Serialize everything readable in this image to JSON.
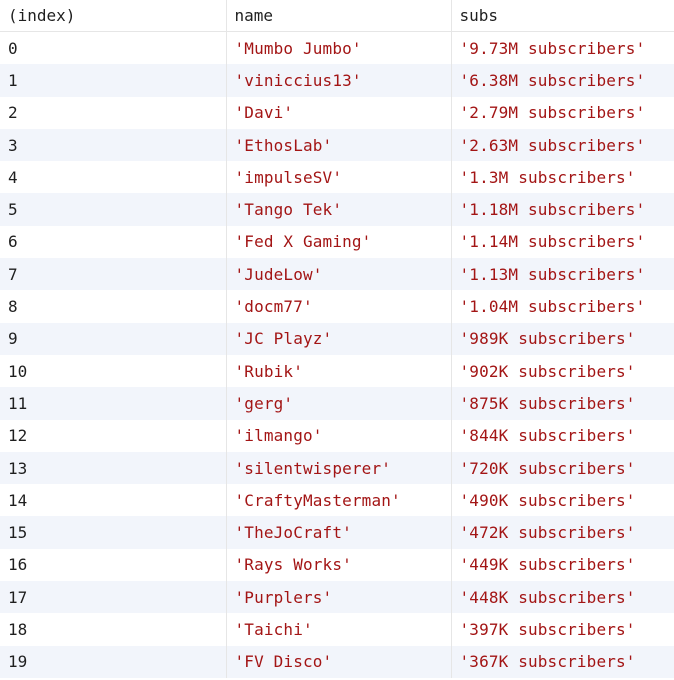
{
  "columns": [
    "(index)",
    "name",
    "subs"
  ],
  "rows": [
    {
      "index": "0",
      "name": "'Mumbo Jumbo'",
      "subs": "'9.73M subscribers'"
    },
    {
      "index": "1",
      "name": "'viniccius13'",
      "subs": "'6.38M subscribers'"
    },
    {
      "index": "2",
      "name": "'Davi'",
      "subs": "'2.79M subscribers'"
    },
    {
      "index": "3",
      "name": "'EthosLab'",
      "subs": "'2.63M subscribers'"
    },
    {
      "index": "4",
      "name": "'impulseSV'",
      "subs": "'1.3M subscribers'"
    },
    {
      "index": "5",
      "name": "'Tango Tek'",
      "subs": "'1.18M subscribers'"
    },
    {
      "index": "6",
      "name": "'Fed X Gaming'",
      "subs": "'1.14M subscribers'"
    },
    {
      "index": "7",
      "name": "'JudeLow'",
      "subs": "'1.13M subscribers'"
    },
    {
      "index": "8",
      "name": "'docm77'",
      "subs": "'1.04M subscribers'"
    },
    {
      "index": "9",
      "name": "'JC Playz'",
      "subs": "'989K subscribers'"
    },
    {
      "index": "10",
      "name": "'Rubik'",
      "subs": "'902K subscribers'"
    },
    {
      "index": "11",
      "name": "'gerg'",
      "subs": "'875K subscribers'"
    },
    {
      "index": "12",
      "name": "'ilmango'",
      "subs": "'844K subscribers'"
    },
    {
      "index": "13",
      "name": "'silentwisperer'",
      "subs": "'720K subscribers'"
    },
    {
      "index": "14",
      "name": "'CraftyMasterman'",
      "subs": "'490K subscribers'"
    },
    {
      "index": "15",
      "name": "'TheJoCraft'",
      "subs": "'472K subscribers'"
    },
    {
      "index": "16",
      "name": "'Rays Works'",
      "subs": "'449K subscribers'"
    },
    {
      "index": "17",
      "name": "'Purplers'",
      "subs": "'448K subscribers'"
    },
    {
      "index": "18",
      "name": "'Taichi'",
      "subs": "'397K subscribers'"
    },
    {
      "index": "19",
      "name": "'FV Disco'",
      "subs": "'367K subscribers'"
    }
  ]
}
